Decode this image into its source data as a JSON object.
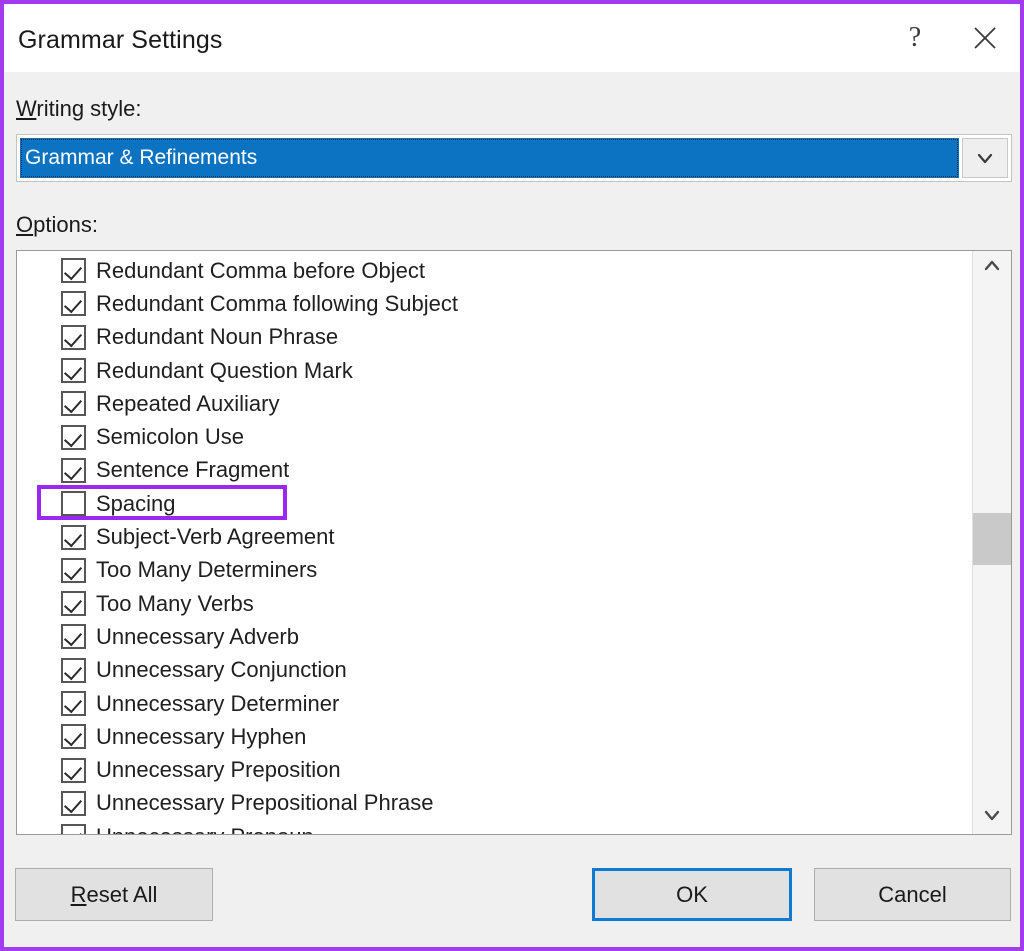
{
  "dialog": {
    "title": "Grammar Settings",
    "accent_border_color": "#A33BF0",
    "titlebar": {
      "help_icon": "question-mark-icon",
      "close_icon": "close-icon"
    }
  },
  "writing_style": {
    "label_prefix": "W",
    "label_rest": "riting style:",
    "selected_value": "Grammar & Refinements",
    "dropdown_icon": "chevron-down-icon",
    "highlight_color": "#0C73C2"
  },
  "options": {
    "label_prefix": "O",
    "label_rest": "ptions:",
    "items": [
      {
        "label": "Redundant Comma before Object",
        "checked": true,
        "annotated": false
      },
      {
        "label": "Redundant Comma following Subject",
        "checked": true,
        "annotated": false
      },
      {
        "label": "Redundant Noun Phrase",
        "checked": true,
        "annotated": false
      },
      {
        "label": "Redundant Question Mark",
        "checked": true,
        "annotated": false
      },
      {
        "label": "Repeated Auxiliary",
        "checked": true,
        "annotated": false
      },
      {
        "label": "Semicolon Use",
        "checked": true,
        "annotated": false
      },
      {
        "label": "Sentence Fragment",
        "checked": true,
        "annotated": false
      },
      {
        "label": "Spacing",
        "checked": false,
        "annotated": true
      },
      {
        "label": "Subject-Verb Agreement",
        "checked": true,
        "annotated": false
      },
      {
        "label": "Too Many Determiners",
        "checked": true,
        "annotated": false
      },
      {
        "label": "Too Many Verbs",
        "checked": true,
        "annotated": false
      },
      {
        "label": "Unnecessary Adverb",
        "checked": true,
        "annotated": false
      },
      {
        "label": "Unnecessary Conjunction",
        "checked": true,
        "annotated": false
      },
      {
        "label": "Unnecessary Determiner",
        "checked": true,
        "annotated": false
      },
      {
        "label": "Unnecessary Hyphen",
        "checked": true,
        "annotated": false
      },
      {
        "label": "Unnecessary Preposition",
        "checked": true,
        "annotated": false
      },
      {
        "label": "Unnecessary Prepositional Phrase",
        "checked": true,
        "annotated": false
      },
      {
        "label": "Unnecessary Pronoun",
        "checked": true,
        "annotated": false
      }
    ],
    "annotation_color": "#9C27F0",
    "scrollbar": {
      "up_icon": "chevron-up-icon",
      "down_icon": "chevron-down-icon"
    }
  },
  "footer": {
    "reset_all_prefix": "R",
    "reset_all_rest": "eset All",
    "ok_label": "OK",
    "cancel_label": "Cancel",
    "focus_color": "#0C7BD4"
  }
}
